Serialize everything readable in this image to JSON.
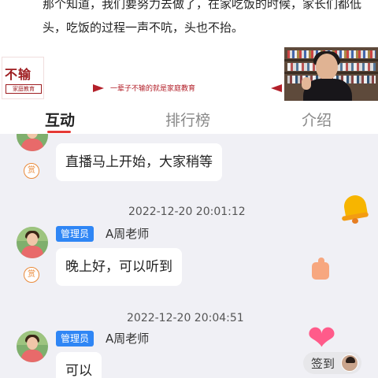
{
  "slide": {
    "line1": "那个知道，我们要努力去做了，在家吃饭的时候，家长们都低",
    "line2": "头，吃饭的过程一声不吭，头也不抬。",
    "logo_big": "不输",
    "logo_small": "家庭教育",
    "slogan": "一辈子不输的就是家庭教育"
  },
  "tabs": [
    {
      "label": "互动"
    },
    {
      "label": "排行榜"
    },
    {
      "label": "介绍"
    }
  ],
  "reward_label": "赏",
  "messages": [
    {
      "text": "直播马上开始，大家稍等"
    },
    {
      "timestamp": "2022-12-20 20:01:12",
      "badge": "管理员",
      "sender": "A周老师",
      "text": "晚上好，可以听到"
    },
    {
      "timestamp": "2022-12-20 20:04:51",
      "badge": "管理员",
      "sender": "A周老师",
      "text": "可以"
    }
  ],
  "checkin": {
    "label": "签到"
  },
  "colors": {
    "accent": "#e53935",
    "badge": "#2f86f5",
    "chat_bg": "#f0f0f5",
    "reward": "#e98a3a"
  }
}
